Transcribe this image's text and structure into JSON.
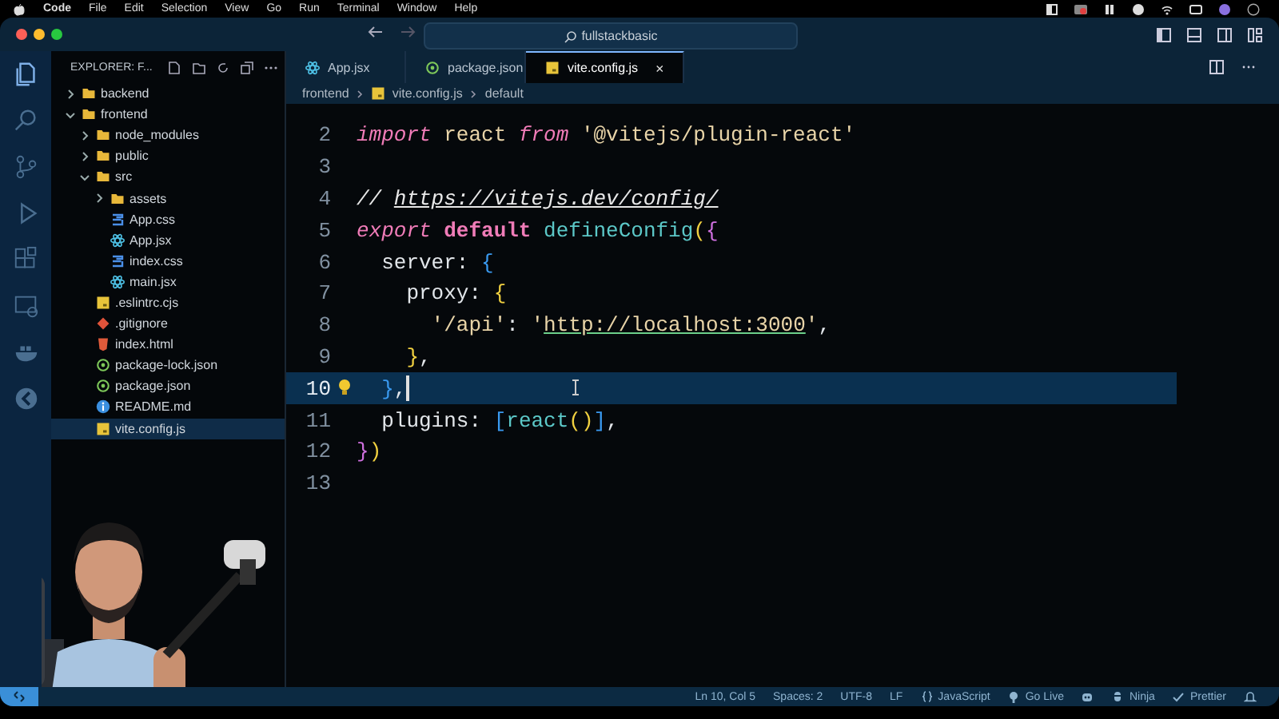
{
  "menu_bar": {
    "app": "Code",
    "items": [
      "File",
      "Edit",
      "Selection",
      "View",
      "Go",
      "Run",
      "Terminal",
      "Window",
      "Help"
    ]
  },
  "title_bar": {
    "search": "fullstackbasic"
  },
  "sidebar": {
    "title": "EXPLORER: F...",
    "tree": [
      {
        "label": "backend",
        "kind": "folder",
        "expanded": false,
        "selected": false
      },
      {
        "label": "frontend",
        "kind": "folder",
        "expanded": true,
        "selected": false,
        "children": [
          {
            "label": "node_modules",
            "kind": "folder",
            "expanded": false,
            "selected": false
          },
          {
            "label": "public",
            "kind": "folder",
            "expanded": false,
            "selected": false
          },
          {
            "label": "src",
            "kind": "folder",
            "expanded": true,
            "selected": false,
            "children": [
              {
                "label": "assets",
                "kind": "folder",
                "expanded": false,
                "selected": false
              },
              {
                "label": "App.css",
                "kind": "css",
                "selected": false
              },
              {
                "label": "App.jsx",
                "kind": "react",
                "selected": false
              },
              {
                "label": "index.css",
                "kind": "css",
                "selected": false
              },
              {
                "label": "main.jsx",
                "kind": "react",
                "selected": false
              }
            ]
          },
          {
            "label": ".eslintrc.cjs",
            "kind": "js",
            "selected": false
          },
          {
            "label": ".gitignore",
            "kind": "git",
            "selected": false
          },
          {
            "label": "index.html",
            "kind": "html",
            "selected": false
          },
          {
            "label": "package-lock.json",
            "kind": "json",
            "selected": false
          },
          {
            "label": "package.json",
            "kind": "json",
            "selected": false
          },
          {
            "label": "README.md",
            "kind": "info",
            "selected": false
          },
          {
            "label": "vite.config.js",
            "kind": "js",
            "selected": true
          }
        ]
      }
    ]
  },
  "tabs": [
    {
      "label": "App.jsx",
      "kind": "react",
      "selected": false
    },
    {
      "label": "package.json",
      "kind": "json",
      "selected": false
    },
    {
      "label": "vite.config.js",
      "kind": "js",
      "selected": true,
      "close": "×"
    }
  ],
  "breadcrumb": [
    "frontend",
    "vite.config.js",
    "default"
  ],
  "code": [
    {
      "number": "2",
      "current": false,
      "tokens": [
        {
          "text": "import ",
          "kind": "kw"
        },
        {
          "text": "react ",
          "kind": "var"
        },
        {
          "text": "from ",
          "kind": "kw"
        },
        {
          "text": "'@vitejs/plugin-react'",
          "kind": "str"
        }
      ]
    },
    {
      "number": "3",
      "current": false
    },
    {
      "number": "4",
      "current": false,
      "tokens": [
        {
          "text": "// ",
          "kind": "comment"
        },
        {
          "text": "https://vitejs.dev/config/",
          "kind": "clink"
        }
      ]
    },
    {
      "number": "5",
      "current": false,
      "tokens": [
        {
          "text": "export ",
          "kind": "kw"
        },
        {
          "text": "default ",
          "kind": "kwb"
        },
        {
          "text": "defineConfig",
          "kind": "fn"
        },
        {
          "text": "(",
          "kind": "b1"
        },
        {
          "text": "{",
          "kind": "b2"
        }
      ]
    },
    {
      "number": "6",
      "current": false,
      "tokens": [
        {
          "text": "  server: ",
          "kind": "plain"
        },
        {
          "text": "{",
          "kind": "b3"
        }
      ]
    },
    {
      "number": "7",
      "current": false,
      "tokens": [
        {
          "text": "    proxy: ",
          "kind": "plain"
        },
        {
          "text": "{",
          "kind": "b1"
        }
      ]
    },
    {
      "number": "8",
      "current": false,
      "tokens": [
        {
          "text": "      '/api'",
          "kind": "str"
        },
        {
          "text": ": ",
          "kind": "plain"
        },
        {
          "text": "'",
          "kind": "str"
        },
        {
          "text": "http://localhost:3000",
          "kind": "slink"
        },
        {
          "text": "'",
          "kind": "str"
        },
        {
          "text": ",",
          "kind": "plain"
        }
      ]
    },
    {
      "number": "9",
      "current": false,
      "tokens": [
        {
          "text": "    }",
          "kind": "b1"
        },
        {
          "text": ",",
          "kind": "plain"
        }
      ]
    },
    {
      "number": "10",
      "current": true,
      "tokens": [
        {
          "text": "  }",
          "kind": "b3"
        },
        {
          "text": ",",
          "kind": "plain"
        }
      ]
    },
    {
      "number": "11",
      "current": false,
      "tokens": [
        {
          "text": "  plugins: ",
          "kind": "plain"
        },
        {
          "text": "[",
          "kind": "b3"
        },
        {
          "text": "react",
          "kind": "fn"
        },
        {
          "text": "()",
          "kind": "b1"
        },
        {
          "text": "]",
          "kind": "b3"
        },
        {
          "text": ",",
          "kind": "plain"
        }
      ]
    },
    {
      "number": "12",
      "current": false,
      "tokens": [
        {
          "text": "}",
          "kind": "b2"
        },
        {
          "text": ")",
          "kind": "b1"
        }
      ]
    },
    {
      "number": "13",
      "current": false
    }
  ],
  "status_bar": {
    "items": [
      {
        "label": "Ln 10, Col 5",
        "kind": "text"
      },
      {
        "label": "Spaces: 2",
        "kind": "text"
      },
      {
        "label": "UTF-8",
        "kind": "text"
      },
      {
        "label": "LF",
        "kind": "text"
      },
      {
        "label": "JavaScript",
        "kind": "lang"
      },
      {
        "label": "Go Live",
        "kind": "live"
      },
      {
        "kind": "copilot"
      },
      {
        "label": "Ninja",
        "kind": "ninja"
      },
      {
        "label": "Prettier",
        "kind": "check"
      },
      {
        "kind": "bell"
      }
    ]
  }
}
